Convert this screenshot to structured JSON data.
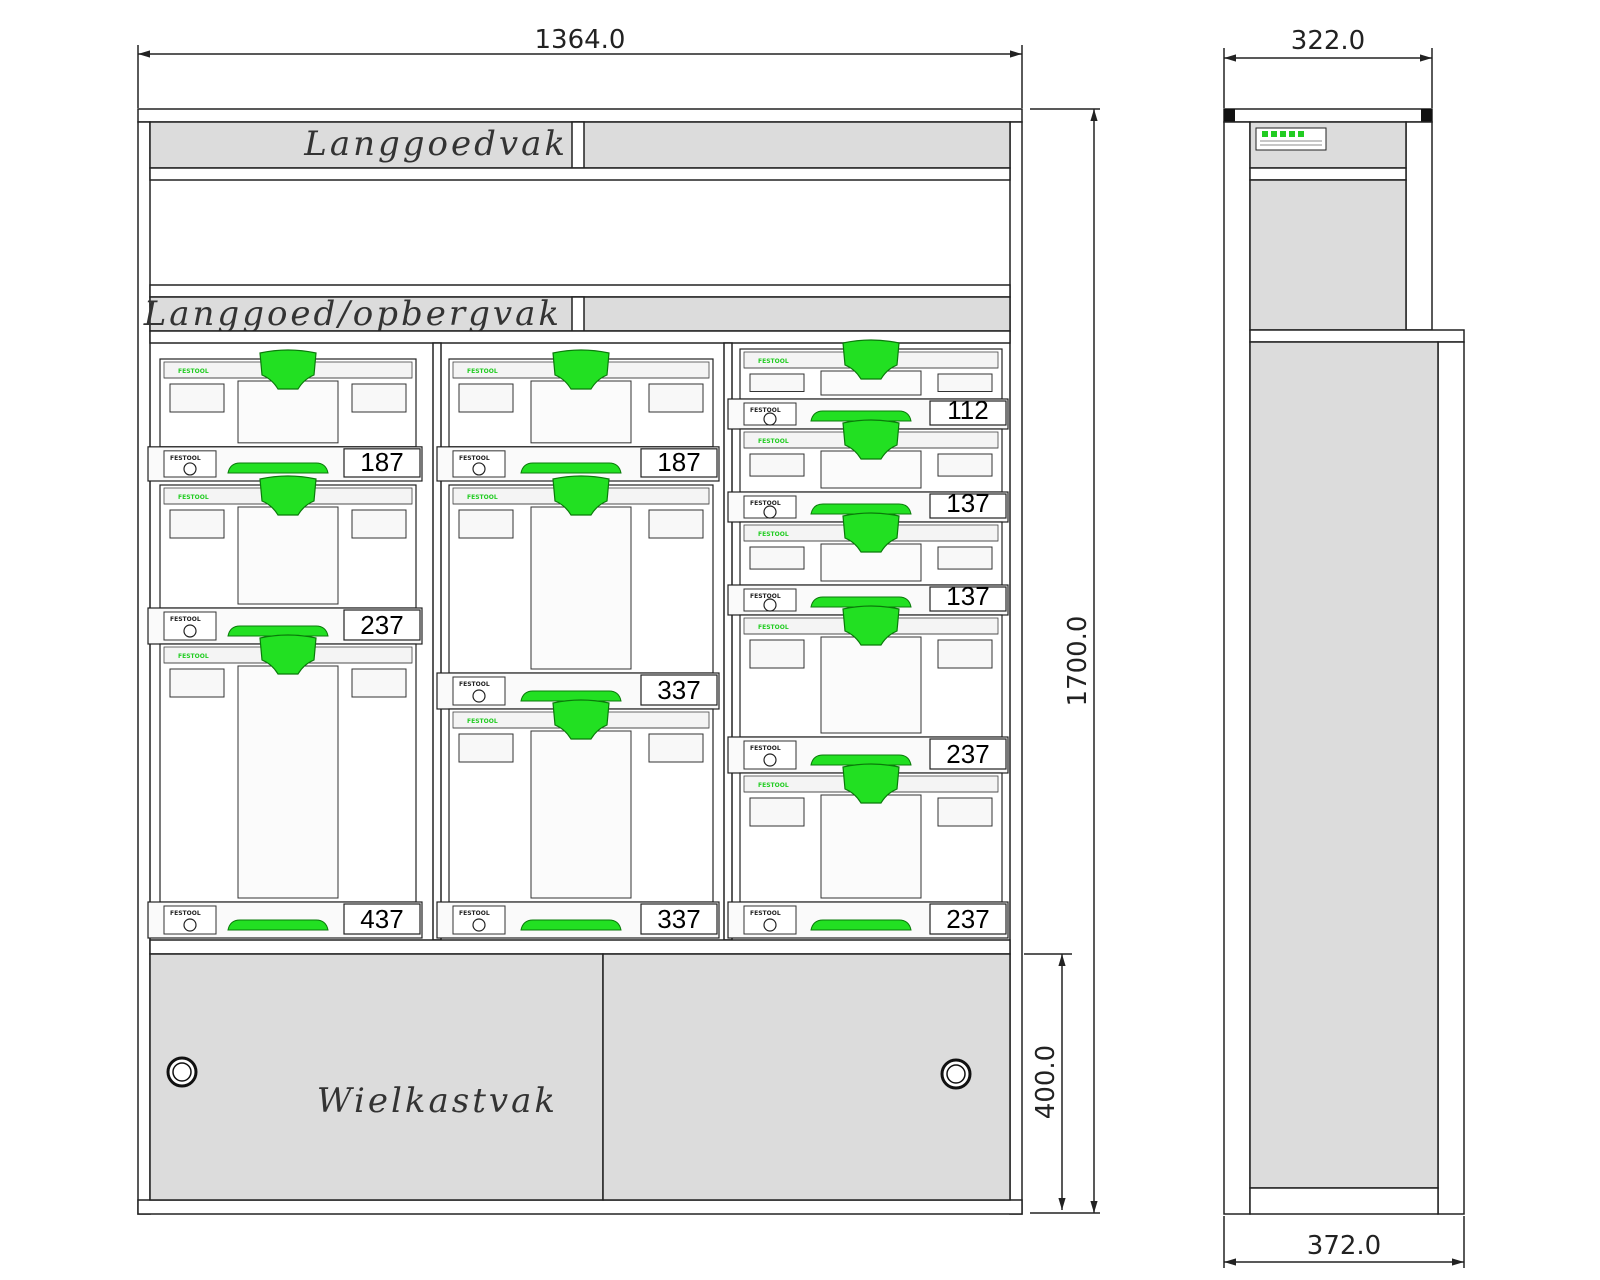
{
  "dimensions": {
    "front_width": "1364.0",
    "side_top_depth": "322.0",
    "side_bottom_depth": "372.0",
    "total_height": "1700.0",
    "base_height": "400.0"
  },
  "labels": {
    "long_goods_compartment": "Langgoedvak",
    "long_goods_storage": "Langgoed/opbergvak",
    "wheel_case_compartment": "Wielkastvak"
  },
  "systainer_brand": "FESTOOL",
  "columns": [
    {
      "name": "left",
      "systainers": [
        "187",
        "237",
        "437"
      ]
    },
    {
      "name": "middle",
      "systainers": [
        "187",
        "337",
        "337"
      ]
    },
    {
      "name": "right",
      "systainers": [
        "112",
        "137",
        "137",
        "237",
        "237"
      ]
    }
  ],
  "colors": {
    "panel_fill": "#dcdcdc",
    "handle_green": "#22e022",
    "brand_green": "#22cc22",
    "line": "#222222"
  }
}
